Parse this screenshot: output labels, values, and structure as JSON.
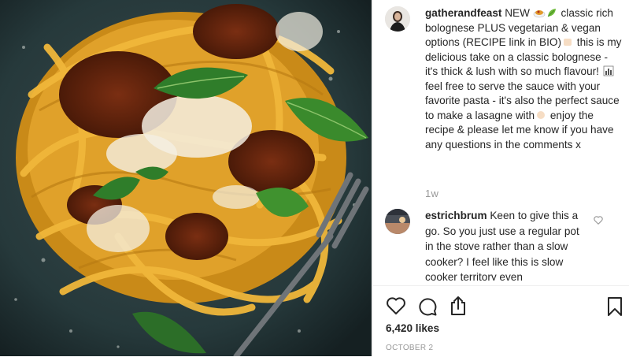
{
  "post": {
    "image_alt": "Bowl of tagliatelle pasta with bolognese sauce, grated parmesan and fresh basil leaves on a dark plate with a fork",
    "author": "gatherandfeast",
    "caption_parts": [
      " NEW ",
      " classic rich bolognese PLUS vegetarian & vegan options (RECIPE link in BIO)",
      " this is my delicious take on a classic bolognese - it's thick & lush with so much flavour! ",
      " feel free to serve the sauce with your favorite pasta - it's also the perfect sauce to make a lasagne with",
      " enjoy the recipe & please let me know if you have any questions in the comments x"
    ],
    "time_ago": "1w",
    "likes": "6,420 likes",
    "date": "OCTOBER 2"
  },
  "comment": {
    "author": "estrichbrum",
    "text": " Keen to give this a go. So you just use a regular pot in the stove rather than a slow cooker? I feel like this is slow cooker territory even"
  },
  "icons": {
    "like": "heart-icon",
    "comment": "speech-bubble-icon",
    "share": "share-icon",
    "save": "bookmark-icon",
    "comment_like": "small-heart-icon"
  }
}
